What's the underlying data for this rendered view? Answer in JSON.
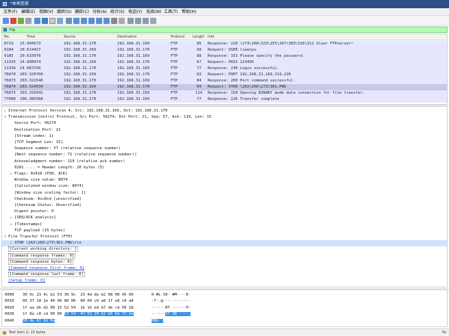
{
  "window": {
    "title": "*本地连接"
  },
  "menu": [
    "文件(F)",
    "编辑(E)",
    "视图(V)",
    "跳转(G)",
    "捕获(C)",
    "分析(A)",
    "统计(S)",
    "电话(Y)",
    "无线(W)",
    "工具(T)",
    "帮助(H)"
  ],
  "filter": {
    "value": "ftp"
  },
  "packet_list": {
    "columns": [
      "No.",
      "Time",
      "Source",
      "Destination",
      "Protocol",
      "Length",
      "Info"
    ],
    "rows": [
      {
        "no": "8719",
        "time": "15.994573",
        "src": "192.168.31.170",
        "dst": "192.168.31.169",
        "proto": "FTP",
        "len": "85",
        "info": "Response: 220 \\273\\266\\323\\255\\267\\303\\316\\312 Slyar FTPserver!"
      },
      {
        "no": "9184",
        "time": "20.614427",
        "src": "192.168.31.169",
        "dst": "192.168.31.170",
        "proto": "FTP",
        "len": "68",
        "info": "Request: USER liwenyu"
      },
      {
        "no": "9185",
        "time": "20.615078",
        "src": "192.168.31.170",
        "dst": "192.168.31.169",
        "proto": "FTP",
        "len": "88",
        "info": "Response: 331 Please specify the password."
      },
      {
        "no": "11335",
        "time": "24.008974",
        "src": "192.168.31.169",
        "dst": "192.168.31.170",
        "proto": "FTP",
        "len": "67",
        "info": "Request: PASS 123456"
      },
      {
        "no": "11336",
        "time": "24.087339",
        "src": "192.168.31.170",
        "dst": "192.168.31.169",
        "proto": "FTP",
        "len": "77",
        "info": "Response: 230 Login successful."
      },
      {
        "no": "76870",
        "time": "203.320760",
        "src": "192.168.31.169",
        "dst": "192.168.31.170",
        "proto": "FTP",
        "len": "83",
        "info": "Request: PORT 192,168,31,169,219,220"
      },
      {
        "no": "76873",
        "time": "203.321540",
        "src": "192.168.31.170",
        "dst": "192.168.31.169",
        "proto": "FTP",
        "len": "84",
        "info": "Response: 200 Port command successful."
      },
      {
        "no": "76874",
        "time": "203.324534",
        "src": "192.168.31.169",
        "dst": "192.168.31.170",
        "proto": "FTP",
        "len": "69",
        "info": "Request: STOR \\262\\266\\273\\361.PNG"
      },
      {
        "no": "76875",
        "time": "203.329341",
        "src": "192.168.31.170",
        "dst": "192.168.31.169",
        "proto": "FTP",
        "len": "114",
        "info": "Response: 150 Opening BINARY mode data connection for file transfer."
      },
      {
        "no": "77080",
        "time": "206.389368",
        "src": "192.168.31.170",
        "dst": "192.168.31.169",
        "proto": "FTP",
        "len": "77",
        "info": "Response: 226 Transfer complete"
      }
    ]
  },
  "details": [
    {
      "indent": 0,
      "arrow": "▷",
      "text": "Internet Protocol Version 4, Src: 192.168.31.169, Dst: 192.168.31.170"
    },
    {
      "indent": 0,
      "arrow": "▽",
      "text": "Transmission Control Protocol, Src Port: 56274, Dst Port: 21, Seq: 57, Ack: 119, Len: 15"
    },
    {
      "indent": 1,
      "arrow": "",
      "text": "Source Port: 56274"
    },
    {
      "indent": 1,
      "arrow": "",
      "text": "Destination Port: 21"
    },
    {
      "indent": 1,
      "arrow": "",
      "text": "[Stream index: 1]"
    },
    {
      "indent": 1,
      "arrow": "",
      "text": "[TCP Segment Len: 15]"
    },
    {
      "indent": 1,
      "arrow": "",
      "text": "Sequence number: 57    (relative sequence number)"
    },
    {
      "indent": 1,
      "arrow": "",
      "text": "[Next sequence number: 72    (relative sequence number)]"
    },
    {
      "indent": 1,
      "arrow": "",
      "text": "Acknowledgment number: 119    (relative ack number)"
    },
    {
      "indent": 1,
      "arrow": "",
      "text": "0101 .... = Header Length: 20 bytes (5)"
    },
    {
      "indent": 1,
      "arrow": "▷",
      "text": "Flags: 0x018 (PSH, ACK)"
    },
    {
      "indent": 1,
      "arrow": "",
      "text": "Window size value: 8074"
    },
    {
      "indent": 1,
      "arrow": "",
      "text": "[Calculated window size: 8074]"
    },
    {
      "indent": 1,
      "arrow": "",
      "text": "[Window size scaling factor: 1]"
    },
    {
      "indent": 1,
      "arrow": "",
      "text": "Checksum: 0xc8cd [unverified]"
    },
    {
      "indent": 1,
      "arrow": "",
      "text": "[Checksum Status: Unverified]"
    },
    {
      "indent": 1,
      "arrow": "",
      "text": "Urgent pointer: 0"
    },
    {
      "indent": 1,
      "arrow": "▷",
      "text": "[SEQ/ACK analysis]"
    },
    {
      "indent": 1,
      "arrow": "▷",
      "text": "[Timestamps]"
    },
    {
      "indent": 1,
      "arrow": "",
      "text": "TCP payload (15 bytes)"
    },
    {
      "indent": 0,
      "arrow": "▽",
      "text": "File Transfer Protocol (FTP)"
    },
    {
      "indent": 1,
      "arrow": "▷",
      "text": "STOR \\262\\266\\273\\361.PNG\\r\\n",
      "selected": true
    },
    {
      "indent": 0,
      "arrow": "",
      "text": "[Current working directory: ]",
      "boxed": true
    },
    {
      "indent": 0,
      "arrow": "",
      "text": "[Command response frames: 0]",
      "boxed": true
    },
    {
      "indent": 0,
      "arrow": "",
      "text": "[Command response bytes: 0]",
      "boxed": true
    },
    {
      "indent": 0,
      "arrow": "",
      "text": "[Command response first frame: 0]",
      "link": true
    },
    {
      "indent": 0,
      "arrow": "",
      "text": "[Command response last frame: 0]",
      "boxed": true
    },
    {
      "indent": 0,
      "arrow": "",
      "text": "[Setup frame: 0]",
      "link": true
    }
  ],
  "bytes": [
    {
      "offset": "0000",
      "hex_plain": "30 9c 23 4c b2 53 30 9c  23 4d de b2 08 00 45 00",
      "hex_hl": "",
      "hex_tail": "",
      "ascii_plain": "0·#L·S0· #M····E·",
      "ascii_hl": ""
    },
    {
      "offset": "0010",
      "hex_plain": "00 37 10 2e 40 00 80 06  00 00 c0 a8 1f a9 c0 a8",
      "hex_hl": "",
      "hex_tail": "",
      "ascii_plain": "·7·.@··· ········",
      "ascii_hl": ""
    },
    {
      "offset": "0020",
      "hex_plain": "1f aa db d2 00 15 52 54  1b 1b ed b7 de cd 50 18",
      "hex_hl": "",
      "hex_tail": "",
      "ascii_plain": "······RT ······P·",
      "ascii_hl": ""
    },
    {
      "offset": "0030",
      "hex_plain": "1f 8a c8 cd 00 00 ",
      "hex_hl": "53 54  4f 52 20 b2 b6 bb f1 2e",
      "hex_tail": "",
      "ascii_plain": "······",
      "ascii_hl": "ST OR ····."
    },
    {
      "offset": "0040",
      "hex_plain": "",
      "hex_hl": "50 4e 47 0d 0a",
      "hex_tail": "",
      "ascii_plain": "",
      "ascii_hl": "PNG··"
    }
  ],
  "status": {
    "text": "Text item (), 15 bytes",
    "right": "Pa"
  },
  "colors": {
    "filter_ok": "#afffaf",
    "row_bg": "#e7e6ff",
    "row_selected": "#c6c9e4",
    "byte_highlight": "#3a8ee6"
  }
}
